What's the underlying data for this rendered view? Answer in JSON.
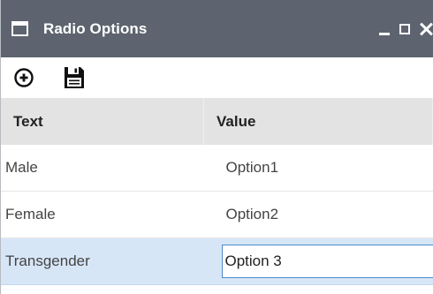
{
  "window": {
    "title": "Radio Options",
    "icon": "window-icon",
    "controls": [
      "minimize-icon",
      "maximize-icon",
      "close-icon"
    ]
  },
  "toolbar": {
    "buttons": [
      {
        "icon": "add-circle-icon"
      },
      {
        "icon": "save-icon"
      }
    ]
  },
  "grid": {
    "columns": [
      "Text",
      "Value"
    ],
    "rows": [
      {
        "text": "Male",
        "value": "Option1"
      },
      {
        "text": "Female",
        "value": "Option2"
      },
      {
        "text": "Transgender",
        "value": "Option 3"
      }
    ],
    "selected_row": 2
  },
  "colors": {
    "titlebar": "#5d646f",
    "header_bg": "#e3e3e3",
    "selected_bg": "#d7e6f7",
    "edit_border": "#4f8ac9"
  }
}
